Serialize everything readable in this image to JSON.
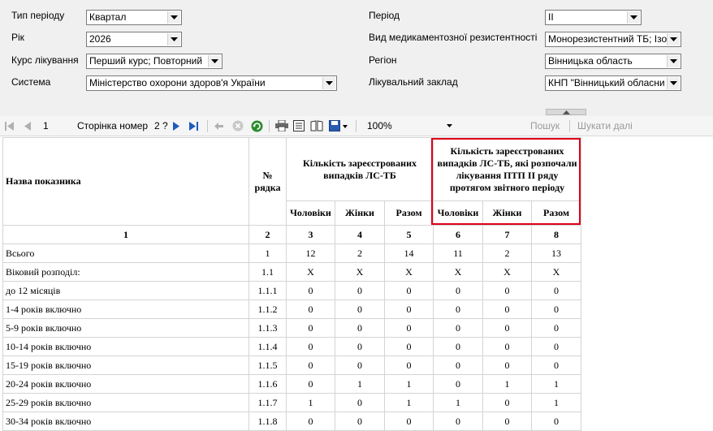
{
  "params": {
    "period_type": {
      "label": "Тип періоду",
      "value": "Квартал"
    },
    "year": {
      "label": "Рік",
      "value": "2026"
    },
    "course": {
      "label": "Курс лікування",
      "value": "Перший курс; Повторний"
    },
    "system": {
      "label": "Система",
      "value": "Міністерство охорони здоров'я України"
    },
    "period": {
      "label": "Період",
      "value": "II"
    },
    "resistance": {
      "label": "Вид медикаментозної резистентності",
      "value": "Монорезистентний ТБ; Ізо"
    },
    "region": {
      "label": "Регіон",
      "value": "Вінницька область"
    },
    "facility": {
      "label": "Лікувальний заклад",
      "value": "КНП \"Вінницький обласни"
    }
  },
  "toolbar": {
    "page_input": "1",
    "page_label": "Сторінка номер",
    "page_of": "2 ?",
    "zoom": "100%",
    "search_label": "Пошук",
    "search_next_label": "Шукати далі"
  },
  "table": {
    "h_name": "Назва показника",
    "h_rownum": "№ рядка",
    "h_group1": "Кількість зареєстрованих випадків ЛС-ТБ",
    "h_group2": "Кількість зареєстрованих випадків ЛС-ТБ, які розпочали лікування ПТП ІІ ряду протягом звітного періоду",
    "sub": [
      "Чоловіки",
      "Жінки",
      "Разом",
      "Чоловіки",
      "Жінки",
      "Разом"
    ],
    "col_numbers": [
      "1",
      "2",
      "3",
      "4",
      "5",
      "6",
      "7",
      "8"
    ],
    "rows": [
      [
        "Всього",
        "1",
        "12",
        "2",
        "14",
        "11",
        "2",
        "13"
      ],
      [
        "Віковий розподіл:",
        "1.1",
        "X",
        "X",
        "X",
        "X",
        "X",
        "X"
      ],
      [
        "до 12 місяців",
        "1.1.1",
        "0",
        "0",
        "0",
        "0",
        "0",
        "0"
      ],
      [
        "1-4 років включно",
        "1.1.2",
        "0",
        "0",
        "0",
        "0",
        "0",
        "0"
      ],
      [
        "5-9 років включно",
        "1.1.3",
        "0",
        "0",
        "0",
        "0",
        "0",
        "0"
      ],
      [
        "10-14 років включно",
        "1.1.4",
        "0",
        "0",
        "0",
        "0",
        "0",
        "0"
      ],
      [
        "15-19 років включно",
        "1.1.5",
        "0",
        "0",
        "0",
        "0",
        "0",
        "0"
      ],
      [
        "20-24 років включно",
        "1.1.6",
        "0",
        "1",
        "1",
        "0",
        "1",
        "1"
      ],
      [
        "25-29 років включно",
        "1.1.7",
        "1",
        "0",
        "1",
        "1",
        "0",
        "1"
      ],
      [
        "30-34 років включно",
        "1.1.8",
        "0",
        "0",
        "0",
        "0",
        "0",
        "0"
      ]
    ]
  },
  "colors": {
    "highlight": "#e0001a",
    "panel": "#f0f0f0",
    "nav_blue": "#1e5bbd"
  }
}
